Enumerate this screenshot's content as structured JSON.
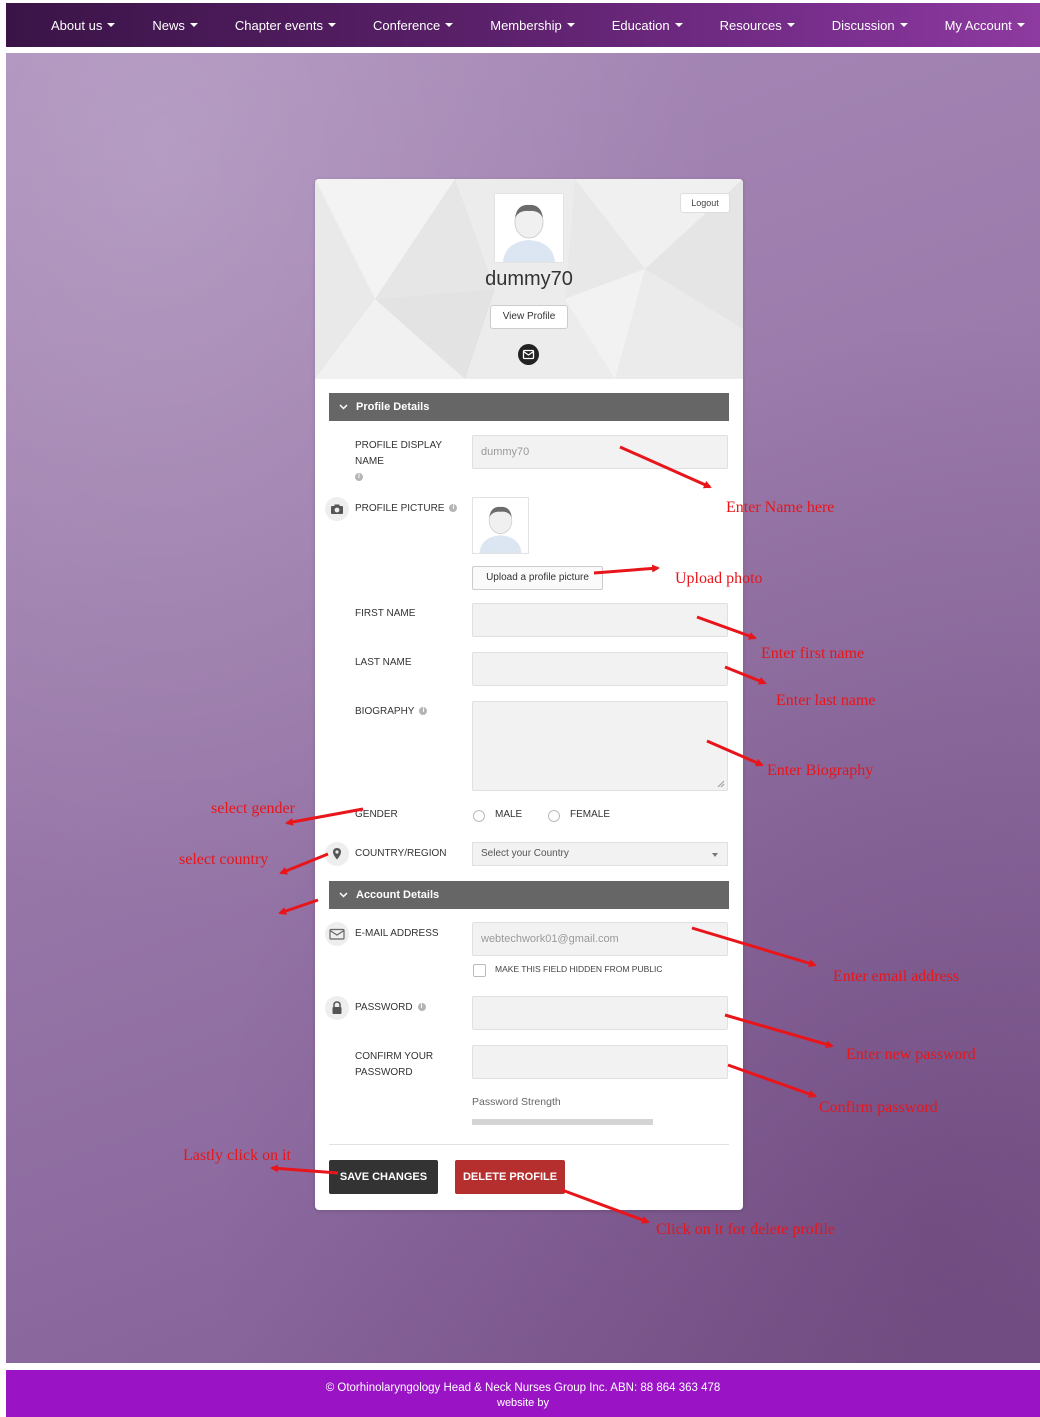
{
  "nav": {
    "items": [
      {
        "label": "About us"
      },
      {
        "label": "News"
      },
      {
        "label": "Chapter events"
      },
      {
        "label": "Conference"
      },
      {
        "label": "Membership"
      },
      {
        "label": "Education"
      },
      {
        "label": "Resources"
      },
      {
        "label": "Discussion"
      },
      {
        "label": "My Account"
      }
    ]
  },
  "profile_header": {
    "logout_label": "Logout",
    "username": "dummy70",
    "view_profile_label": "View Profile"
  },
  "profile_details": {
    "section_title": "Profile Details",
    "display_name_label_1": "PROFILE DISPLAY",
    "display_name_label_2": "NAME",
    "display_name_value": "dummy70",
    "picture_label": "PROFILE PICTURE",
    "upload_label": "Upload a profile picture",
    "first_name_label": "FIRST NAME",
    "last_name_label": "LAST NAME",
    "biography_label": "BIOGRAPHY",
    "gender_label": "GENDER",
    "gender_options": [
      "MALE",
      "FEMALE"
    ],
    "country_label": "COUNTRY/REGION",
    "country_placeholder": "Select your Country"
  },
  "account_details": {
    "section_title": "Account Details",
    "email_label": "E-MAIL ADDRESS",
    "email_value": "webtechwork01@gmail.com",
    "hide_email_label": "MAKE THIS FIELD HIDDEN FROM PUBLIC",
    "password_label": "PASSWORD",
    "confirm_label_1": "CONFIRM YOUR",
    "confirm_label_2": "PASSWORD",
    "strength_label": "Password Strength"
  },
  "actions": {
    "save_label": "SAVE CHANGES",
    "delete_label": "DELETE PROFILE"
  },
  "annotations": {
    "name": "Enter Name here",
    "photo": "Upload photo",
    "first_name": "Enter first name",
    "last_name": "Enter last name",
    "biography": "Enter Biography",
    "gender": "select gender",
    "country": "select country",
    "email": "Enter email address",
    "new_password": "Enter new password",
    "confirm_password": "Confirm password",
    "save": "Lastly click on it",
    "delete": "Click on it for delete profile"
  },
  "footer": {
    "line1": "© Otorhinolaryngology Head & Neck Nurses Group Inc. ABN: 88 864 363 478",
    "line2": "website by"
  },
  "colors": {
    "nav_start": "#3a1447",
    "nav_end": "#8e3aa0",
    "background": "#9a7aaa",
    "section_bar": "#666666",
    "save_button": "#333333",
    "delete_button": "#b52f2f",
    "annotation": "#e8151a",
    "footer": "#9a14c6"
  }
}
